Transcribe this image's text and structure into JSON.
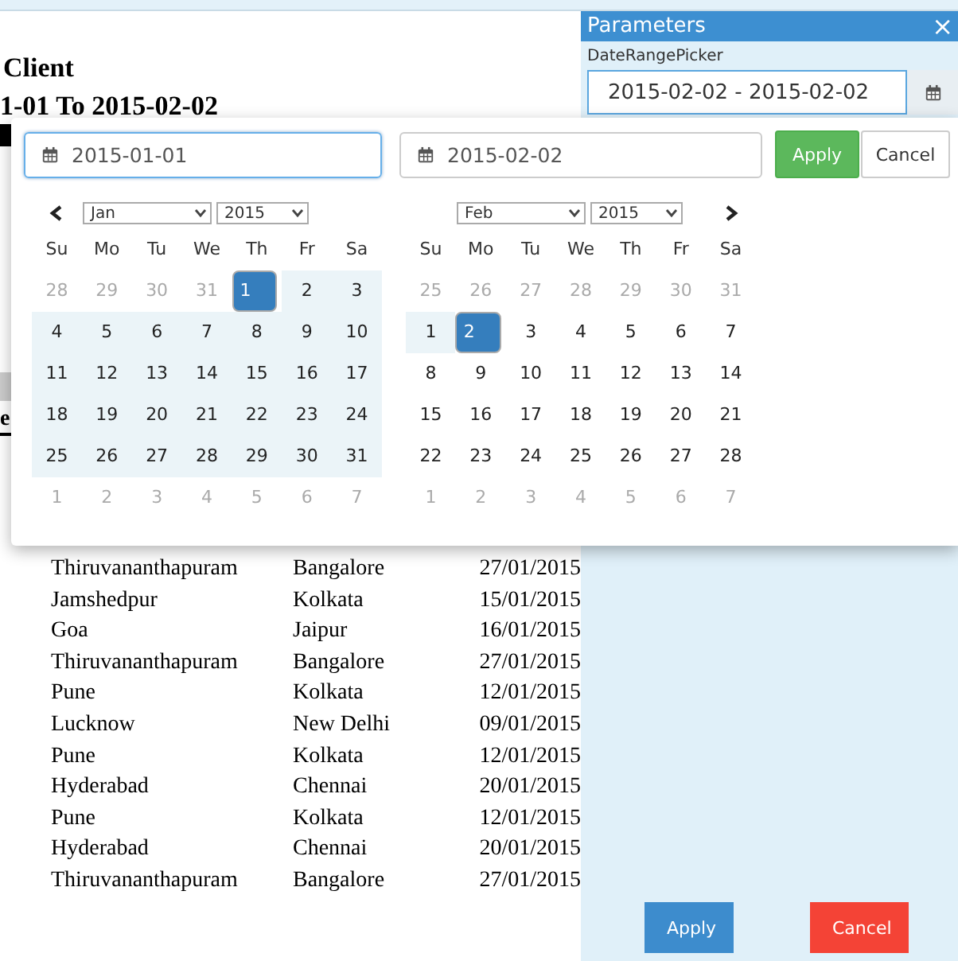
{
  "report": {
    "title": "Client",
    "subtitle": "1-01 To 2015-02-02",
    "header_fragments": [
      "e"
    ],
    "rows": [
      {
        "from": "Thiruvananthapuram",
        "to": "Bangalore",
        "date": "27/01/2015"
      },
      {
        "from": "Jamshedpur",
        "to": "Kolkata",
        "date": "15/01/2015"
      },
      {
        "from": "Goa",
        "to": "Jaipur",
        "date": "16/01/2015"
      },
      {
        "from": "Thiruvananthapuram",
        "to": "Bangalore",
        "date": "27/01/2015"
      },
      {
        "from": "Pune",
        "to": "Kolkata",
        "date": "12/01/2015"
      },
      {
        "from": "Lucknow",
        "to": "New Delhi",
        "date": "09/01/2015"
      },
      {
        "from": "Pune",
        "to": "Kolkata",
        "date": "12/01/2015"
      },
      {
        "from": "Hyderabad",
        "to": "Chennai",
        "date": "20/01/2015"
      },
      {
        "from": "Pune",
        "to": "Kolkata",
        "date": "12/01/2015"
      },
      {
        "from": "Hyderabad",
        "to": "Chennai",
        "date": "20/01/2015"
      },
      {
        "from": "Thiruvananthapuram",
        "to": "Bangalore",
        "date": "27/01/2015"
      }
    ]
  },
  "parameters": {
    "title": "Parameters",
    "close": "×",
    "label": "DateRangePicker",
    "value": "2015-02-02 - 2015-02-02",
    "buttons": [
      {
        "label": "Apply",
        "kind": "primary"
      },
      {
        "label": "Cancel",
        "kind": "danger"
      }
    ]
  },
  "picker": {
    "start": "2015-01-01",
    "end": "2015-02-02",
    "start_focused": true,
    "buttons": [
      {
        "label": "Apply",
        "kind": "primary"
      },
      {
        "label": "Cancel",
        "kind": "default"
      }
    ],
    "calendars": [
      {
        "month": "Jan",
        "year": "2015",
        "weekdays": [
          "Su",
          "Mo",
          "Tu",
          "We",
          "Th",
          "Fr",
          "Sa"
        ],
        "weeks": [
          [
            {
              "day": "28",
              "muted": true,
              "in_range": false,
              "selected": false
            },
            {
              "day": "29",
              "muted": true,
              "in_range": false,
              "selected": false
            },
            {
              "day": "30",
              "muted": true,
              "in_range": false,
              "selected": false
            },
            {
              "day": "31",
              "muted": true,
              "in_range": false,
              "selected": false
            },
            {
              "day": "1",
              "muted": false,
              "in_range": true,
              "selected": true
            },
            {
              "day": "2",
              "muted": false,
              "in_range": true,
              "selected": false
            },
            {
              "day": "3",
              "muted": false,
              "in_range": true,
              "selected": false
            }
          ],
          [
            {
              "day": "4",
              "muted": false,
              "in_range": true,
              "selected": false
            },
            {
              "day": "5",
              "muted": false,
              "in_range": true,
              "selected": false
            },
            {
              "day": "6",
              "muted": false,
              "in_range": true,
              "selected": false
            },
            {
              "day": "7",
              "muted": false,
              "in_range": true,
              "selected": false
            },
            {
              "day": "8",
              "muted": false,
              "in_range": true,
              "selected": false
            },
            {
              "day": "9",
              "muted": false,
              "in_range": true,
              "selected": false
            },
            {
              "day": "10",
              "muted": false,
              "in_range": true,
              "selected": false
            }
          ],
          [
            {
              "day": "11",
              "muted": false,
              "in_range": true,
              "selected": false
            },
            {
              "day": "12",
              "muted": false,
              "in_range": true,
              "selected": false
            },
            {
              "day": "13",
              "muted": false,
              "in_range": true,
              "selected": false
            },
            {
              "day": "14",
              "muted": false,
              "in_range": true,
              "selected": false
            },
            {
              "day": "15",
              "muted": false,
              "in_range": true,
              "selected": false
            },
            {
              "day": "16",
              "muted": false,
              "in_range": true,
              "selected": false
            },
            {
              "day": "17",
              "muted": false,
              "in_range": true,
              "selected": false
            }
          ],
          [
            {
              "day": "18",
              "muted": false,
              "in_range": true,
              "selected": false
            },
            {
              "day": "19",
              "muted": false,
              "in_range": true,
              "selected": false
            },
            {
              "day": "20",
              "muted": false,
              "in_range": true,
              "selected": false
            },
            {
              "day": "21",
              "muted": false,
              "in_range": true,
              "selected": false
            },
            {
              "day": "22",
              "muted": false,
              "in_range": true,
              "selected": false
            },
            {
              "day": "23",
              "muted": false,
              "in_range": true,
              "selected": false
            },
            {
              "day": "24",
              "muted": false,
              "in_range": true,
              "selected": false
            }
          ],
          [
            {
              "day": "25",
              "muted": false,
              "in_range": true,
              "selected": false
            },
            {
              "day": "26",
              "muted": false,
              "in_range": true,
              "selected": false
            },
            {
              "day": "27",
              "muted": false,
              "in_range": true,
              "selected": false
            },
            {
              "day": "28",
              "muted": false,
              "in_range": true,
              "selected": false
            },
            {
              "day": "29",
              "muted": false,
              "in_range": true,
              "selected": false
            },
            {
              "day": "30",
              "muted": false,
              "in_range": true,
              "selected": false
            },
            {
              "day": "31",
              "muted": false,
              "in_range": true,
              "selected": false
            }
          ],
          [
            {
              "day": "1",
              "muted": true,
              "in_range": false,
              "selected": false
            },
            {
              "day": "2",
              "muted": true,
              "in_range": false,
              "selected": false
            },
            {
              "day": "3",
              "muted": true,
              "in_range": false,
              "selected": false
            },
            {
              "day": "4",
              "muted": true,
              "in_range": false,
              "selected": false
            },
            {
              "day": "5",
              "muted": true,
              "in_range": false,
              "selected": false
            },
            {
              "day": "6",
              "muted": true,
              "in_range": false,
              "selected": false
            },
            {
              "day": "7",
              "muted": true,
              "in_range": false,
              "selected": false
            }
          ]
        ]
      },
      {
        "month": "Feb",
        "year": "2015",
        "weekdays": [
          "Su",
          "Mo",
          "Tu",
          "We",
          "Th",
          "Fr",
          "Sa"
        ],
        "weeks": [
          [
            {
              "day": "25",
              "muted": true,
              "in_range": false,
              "selected": false
            },
            {
              "day": "26",
              "muted": true,
              "in_range": false,
              "selected": false
            },
            {
              "day": "27",
              "muted": true,
              "in_range": false,
              "selected": false
            },
            {
              "day": "28",
              "muted": true,
              "in_range": false,
              "selected": false
            },
            {
              "day": "29",
              "muted": true,
              "in_range": false,
              "selected": false
            },
            {
              "day": "30",
              "muted": true,
              "in_range": false,
              "selected": false
            },
            {
              "day": "31",
              "muted": true,
              "in_range": false,
              "selected": false
            }
          ],
          [
            {
              "day": "1",
              "muted": false,
              "in_range": true,
              "selected": false
            },
            {
              "day": "2",
              "muted": false,
              "in_range": true,
              "selected": true
            },
            {
              "day": "3",
              "muted": false,
              "in_range": false,
              "selected": false
            },
            {
              "day": "4",
              "muted": false,
              "in_range": false,
              "selected": false
            },
            {
              "day": "5",
              "muted": false,
              "in_range": false,
              "selected": false
            },
            {
              "day": "6",
              "muted": false,
              "in_range": false,
              "selected": false
            },
            {
              "day": "7",
              "muted": false,
              "in_range": false,
              "selected": false
            }
          ],
          [
            {
              "day": "8",
              "muted": false,
              "in_range": false,
              "selected": false
            },
            {
              "day": "9",
              "muted": false,
              "in_range": false,
              "selected": false
            },
            {
              "day": "10",
              "muted": false,
              "in_range": false,
              "selected": false
            },
            {
              "day": "11",
              "muted": false,
              "in_range": false,
              "selected": false
            },
            {
              "day": "12",
              "muted": false,
              "in_range": false,
              "selected": false
            },
            {
              "day": "13",
              "muted": false,
              "in_range": false,
              "selected": false
            },
            {
              "day": "14",
              "muted": false,
              "in_range": false,
              "selected": false
            }
          ],
          [
            {
              "day": "15",
              "muted": false,
              "in_range": false,
              "selected": false
            },
            {
              "day": "16",
              "muted": false,
              "in_range": false,
              "selected": false
            },
            {
              "day": "17",
              "muted": false,
              "in_range": false,
              "selected": false
            },
            {
              "day": "18",
              "muted": false,
              "in_range": false,
              "selected": false
            },
            {
              "day": "19",
              "muted": false,
              "in_range": false,
              "selected": false
            },
            {
              "day": "20",
              "muted": false,
              "in_range": false,
              "selected": false
            },
            {
              "day": "21",
              "muted": false,
              "in_range": false,
              "selected": false
            }
          ],
          [
            {
              "day": "22",
              "muted": false,
              "in_range": false,
              "selected": false
            },
            {
              "day": "23",
              "muted": false,
              "in_range": false,
              "selected": false
            },
            {
              "day": "24",
              "muted": false,
              "in_range": false,
              "selected": false
            },
            {
              "day": "25",
              "muted": false,
              "in_range": false,
              "selected": false
            },
            {
              "day": "26",
              "muted": false,
              "in_range": false,
              "selected": false
            },
            {
              "day": "27",
              "muted": false,
              "in_range": false,
              "selected": false
            },
            {
              "day": "28",
              "muted": false,
              "in_range": false,
              "selected": false
            }
          ],
          [
            {
              "day": "1",
              "muted": true,
              "in_range": false,
              "selected": false
            },
            {
              "day": "2",
              "muted": true,
              "in_range": false,
              "selected": false
            },
            {
              "day": "3",
              "muted": true,
              "in_range": false,
              "selected": false
            },
            {
              "day": "4",
              "muted": true,
              "in_range": false,
              "selected": false
            },
            {
              "day": "5",
              "muted": true,
              "in_range": false,
              "selected": false
            },
            {
              "day": "6",
              "muted": true,
              "in_range": false,
              "selected": false
            },
            {
              "day": "7",
              "muted": true,
              "in_range": false,
              "selected": false
            }
          ]
        ]
      }
    ]
  }
}
